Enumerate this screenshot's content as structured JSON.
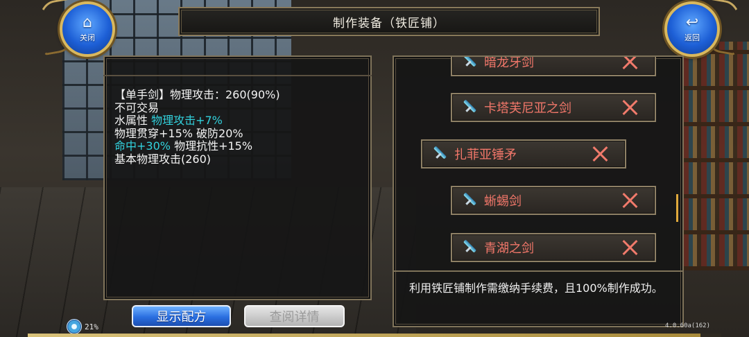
{
  "window": {
    "title": "制作装备（铁匠铺）"
  },
  "buttons": {
    "close": {
      "label": "关闭",
      "icon": "home-icon"
    },
    "back": {
      "label": "返回",
      "icon": "return-icon"
    },
    "show_recipe": "显示配方",
    "view_details": "查阅详情"
  },
  "item_description": {
    "line1": "【单手剑】物理攻击：260(90%)",
    "line2": "不可交易",
    "line3_prefix": "水属性 ",
    "line3_bonus": "物理攻击+7%",
    "line4": "物理贯穿+15% 破防20%",
    "line5_bonus": "命中+30%",
    "line5_suffix": " 物理抗性+15%",
    "line6": "基本物理攻击(260)"
  },
  "recipe_list": {
    "items": [
      {
        "name": "暗龙牙剑"
      },
      {
        "name": "卡塔芙尼亚之剑"
      },
      {
        "name": "扎菲亚锤矛",
        "selected": true
      },
      {
        "name": "蜥蜴剑"
      },
      {
        "name": "青湖之剑"
      }
    ]
  },
  "info": {
    "text": "利用铁匠铺制作需缴纳手续费，且100%制作成功。"
  },
  "status": {
    "percent": "21%",
    "version": "4.0.60a(162)"
  },
  "progress": {
    "fraction": 0.97
  },
  "colors": {
    "accent_blue": "#2a6ee0",
    "item_name": "#f2776a",
    "bonus_cyan": "#32d2de",
    "gold_border": "#d9b85e"
  }
}
